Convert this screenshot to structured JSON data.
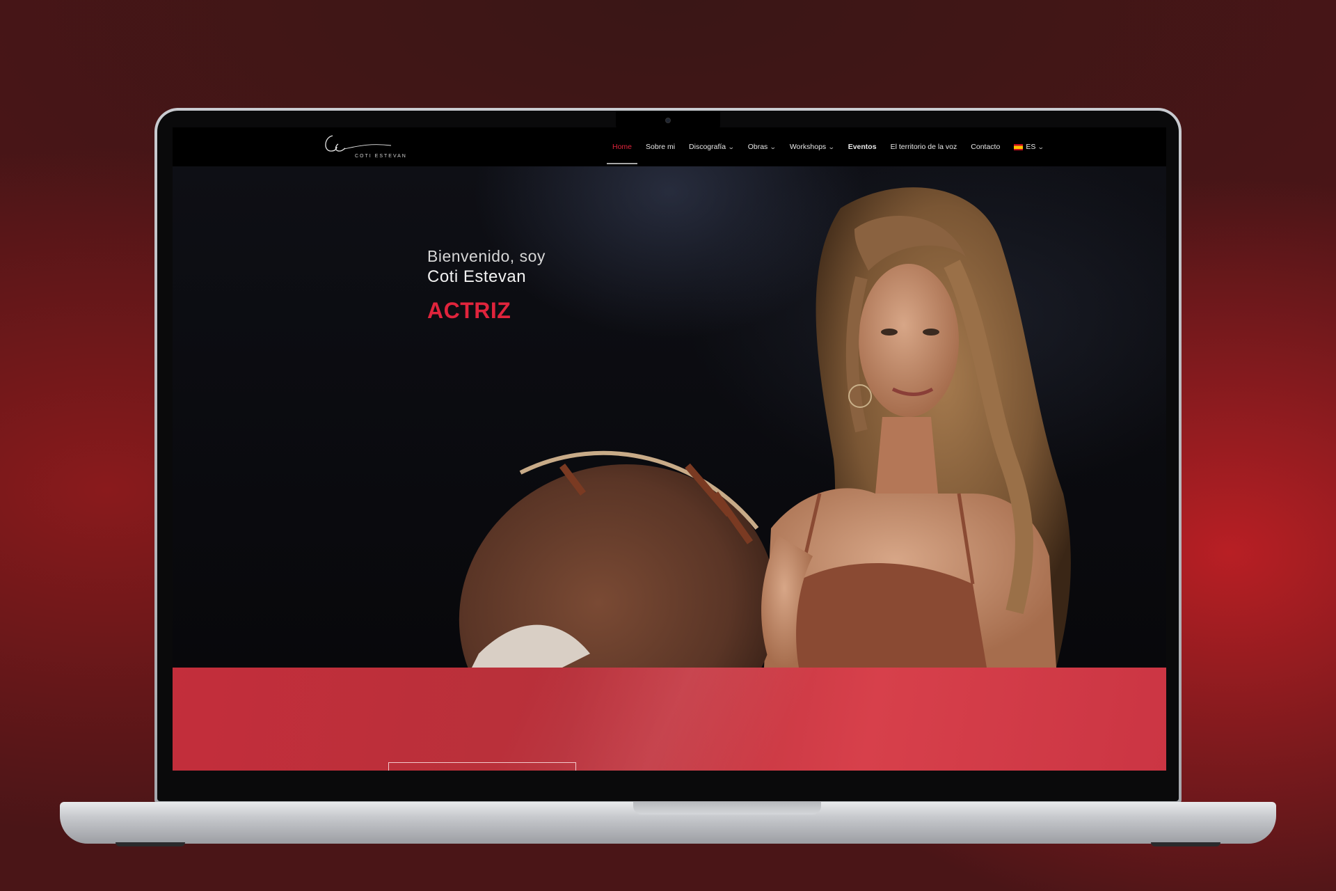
{
  "site": {
    "logo_subtitle": "Coti Estevan",
    "nav": [
      {
        "label": "Home",
        "active": true,
        "dropdown": false
      },
      {
        "label": "Sobre mi",
        "active": false,
        "dropdown": false
      },
      {
        "label": "Discografía",
        "active": false,
        "dropdown": true
      },
      {
        "label": "Obras",
        "active": false,
        "dropdown": true
      },
      {
        "label": "Workshops",
        "active": false,
        "dropdown": true
      },
      {
        "label": "Eventos",
        "active": false,
        "dropdown": false
      },
      {
        "label": "El territorio de la voz",
        "active": false,
        "dropdown": false
      },
      {
        "label": "Contacto",
        "active": false,
        "dropdown": false
      }
    ],
    "language": {
      "label": "ES",
      "icon": "spain-flag-icon"
    }
  },
  "hero": {
    "greeting": "Bienvenido, soy",
    "name": "Coti Estevan",
    "role": "ACTRIZ"
  },
  "colors": {
    "accent": "#e0243c",
    "band": "#c8333f",
    "background": "#4a1517"
  }
}
